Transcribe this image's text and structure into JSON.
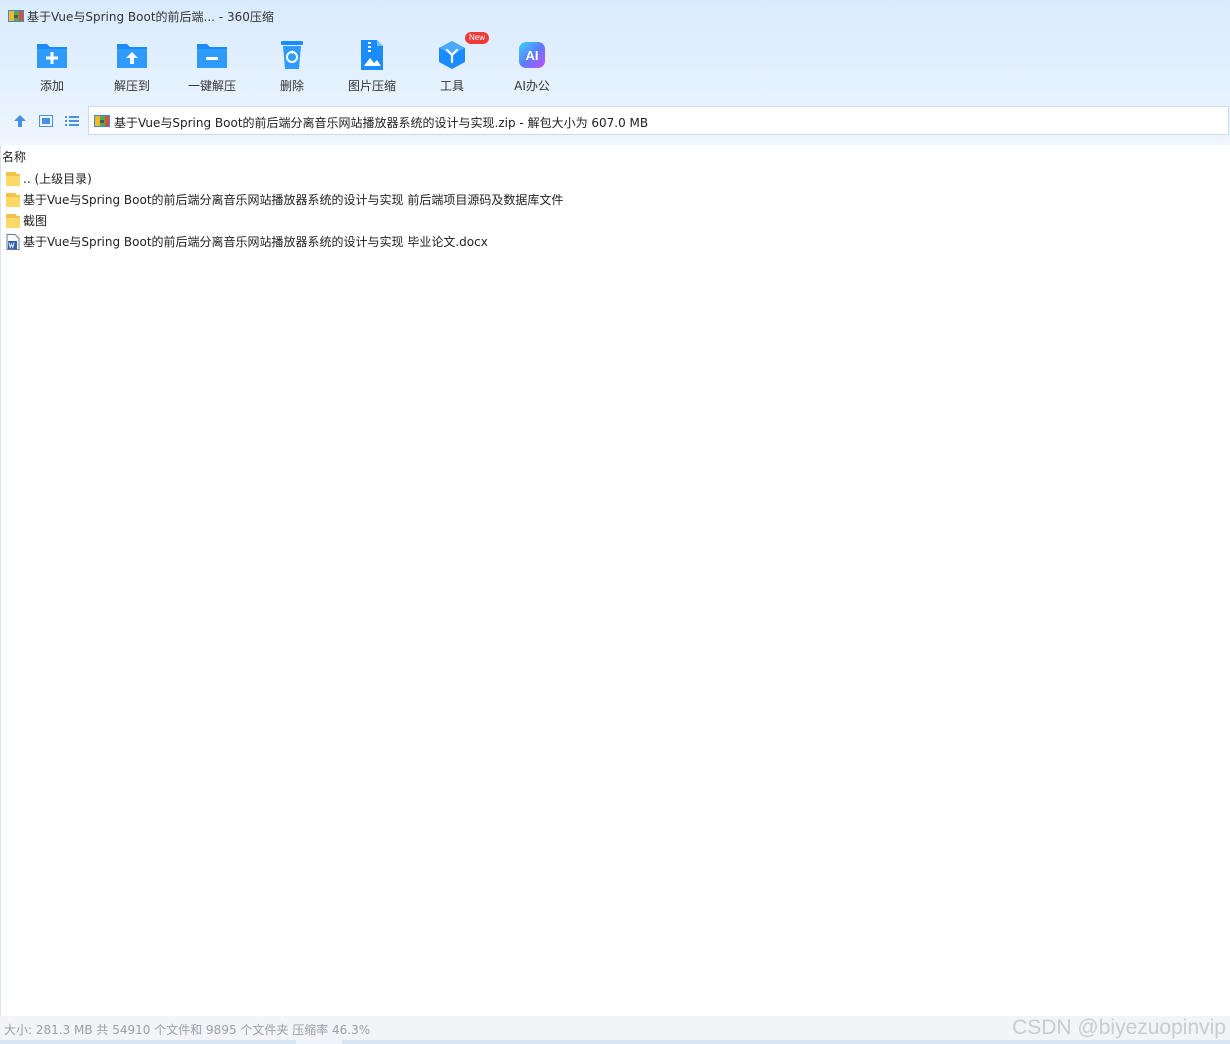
{
  "window": {
    "title": "基于Vue与Spring Boot的前后端... - 360压缩"
  },
  "toolbar": {
    "buttons": [
      {
        "label": "添加",
        "icon": "add-folder-icon"
      },
      {
        "label": "解压到",
        "icon": "extract-to-icon"
      },
      {
        "label": "一键解压",
        "icon": "one-click-extract-icon"
      },
      {
        "label": "删除",
        "icon": "recycle-bin-icon"
      },
      {
        "label": "图片压缩",
        "icon": "image-compress-icon"
      },
      {
        "label": "工具",
        "icon": "tools-cube-icon",
        "badge": "New"
      },
      {
        "label": "AI办公",
        "icon": "ai-office-icon",
        "icon_text": "AI"
      }
    ]
  },
  "address": {
    "text": "基于Vue与Spring Boot的前后端分离音乐网站播放器系统的设计与实现.zip - 解包大小为 607.0 MB"
  },
  "file_list": {
    "column_header": "名称",
    "items": [
      {
        "name": ".. (上级目录)",
        "type": "folder"
      },
      {
        "name": "基于Vue与Spring Boot的前后端分离音乐网站播放器系统的设计与实现 前后端项目源码及数据库文件",
        "type": "folder"
      },
      {
        "name": "截图",
        "type": "folder"
      },
      {
        "name": "基于Vue与Spring Boot的前后端分离音乐网站播放器系统的设计与实现 毕业论文.docx",
        "type": "word-document"
      }
    ]
  },
  "status": {
    "text": "大小: 281.3 MB 共 54910 个文件和 9895 个文件夹 压缩率 46.3%",
    "watermark": "CSDN @biyezuopinvip"
  },
  "colors": {
    "toolbar_bg": "#d9ebfd",
    "icon_blue": "#1a8cff",
    "badge_red": "#f03a3a",
    "folder_yellow": "#ffd968"
  }
}
